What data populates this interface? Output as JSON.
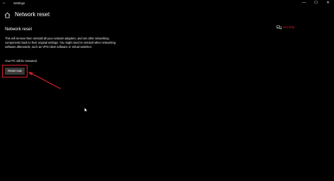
{
  "titlebar": {
    "title": "Settings",
    "back_icon": "back-arrow-icon",
    "minimize": "—",
    "maximize": "☐",
    "close": "✕"
  },
  "header": {
    "home_icon": "home-icon",
    "title": "Network reset"
  },
  "content": {
    "section_title": "Network reset",
    "description": "This will remove then reinstall all your network adapters, and set other networking components back to their original settings. You might need to reinstall other networking software afterwards, such as VPN client software or virtual switches.",
    "restart_note": "Your PC will be restarted.",
    "reset_button_label": "Reset now"
  },
  "help": {
    "icon": "chat-help-icon",
    "label": "Get help"
  },
  "colors": {
    "background": "#000000",
    "accent": "#d7202a",
    "button": "#3a3a3a"
  }
}
